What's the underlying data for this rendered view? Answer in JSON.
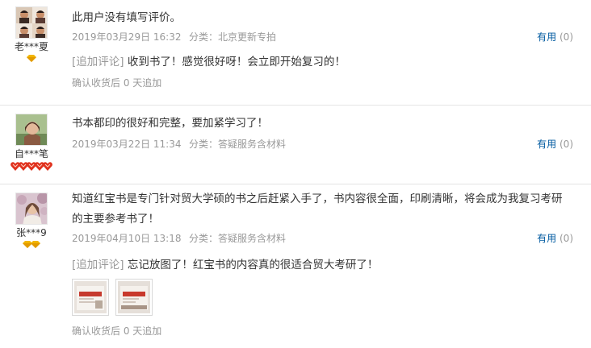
{
  "reviews": [
    {
      "user": "老***夏",
      "badge_icon": "gold-diamond-icon",
      "badge_count": 1,
      "avatar_colors": [
        "#c98f6a",
        "#3b2a24"
      ],
      "content": "此用户没有填写评价。",
      "date": "2019年03月29日 16:32",
      "category": "分类：北京更新专拍",
      "useful_label": "有用",
      "useful_count": "(0)",
      "append_tag": "[追加评论]",
      "append_text": "收到书了！感觉很好呀！会立即开始复习的！",
      "confirm": "确认收货后 0 天追加"
    },
    {
      "user": "自***笔",
      "badge_icon": "red-heart-icon",
      "badge_count": 5,
      "avatar_colors": [
        "#7d9a6a",
        "#8a5a42"
      ],
      "content": "书本都印的很好和完整，要加紧学习了！",
      "date": "2019年03月22日 11:34",
      "category": "分类：答疑服务含材料",
      "useful_label": "有用",
      "useful_count": "(0)"
    },
    {
      "user": "张***9",
      "badge_icon": "gold-diamond-icon",
      "badge_count": 2,
      "avatar_colors": [
        "#c7a7b8",
        "#6d4a3a"
      ],
      "content_lines": [
        "知道红宝书是专门针对贸大学硕的书之后赶紧入手了，书内容很全面，印刷清晰，将会成为我复习考研",
        "的主要参考书了！"
      ],
      "date": "2019年04月10日 13:18",
      "category": "分类：答疑服务含材料",
      "useful_label": "有用",
      "useful_count": "(0)",
      "append_tag": "[追加评论]",
      "append_text": "忘记放图了！红宝书的内容真的很适合贸大考研了！",
      "confirm": "确认收货后 0 天追加"
    }
  ]
}
